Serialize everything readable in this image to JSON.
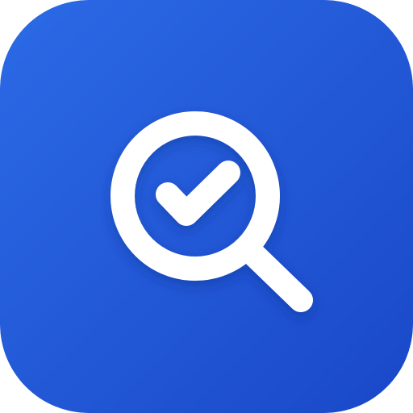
{
  "app_icon": {
    "name": "search-check-app-icon",
    "glyph": "magnifier-with-checkmark-icon",
    "colors": {
      "gradient_top_left": "#2C6AE6",
      "gradient_bottom_right": "#1948C8",
      "glyph": "#FFFFFF"
    }
  }
}
